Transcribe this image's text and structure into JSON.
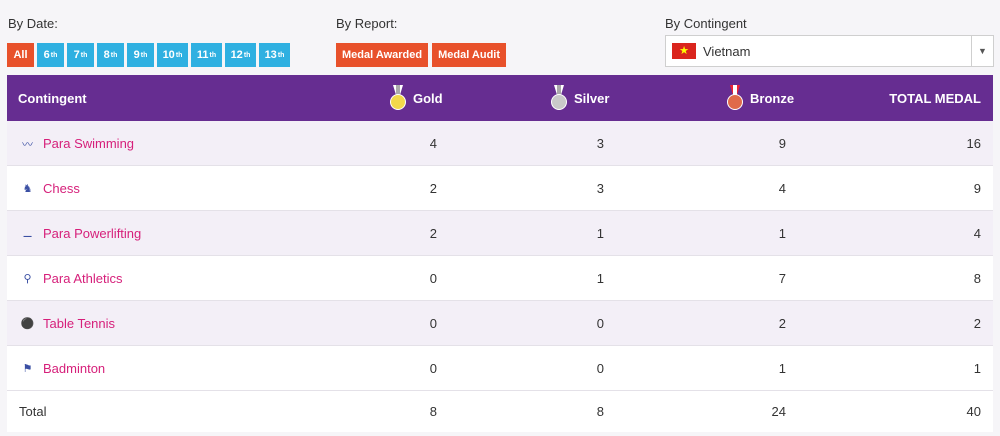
{
  "filters": {
    "date_label": "By Date:",
    "report_label": "By Report:",
    "contingent_label": "By Contingent",
    "date_buttons": [
      {
        "label": "All",
        "sup": ""
      },
      {
        "label": "6",
        "sup": "th"
      },
      {
        "label": "7",
        "sup": "th"
      },
      {
        "label": "8",
        "sup": "th"
      },
      {
        "label": "9",
        "sup": "th"
      },
      {
        "label": "10",
        "sup": "th"
      },
      {
        "label": "11",
        "sup": "th"
      },
      {
        "label": "12",
        "sup": "th"
      },
      {
        "label": "13",
        "sup": "th"
      }
    ],
    "report_buttons": [
      "Medal Awarded",
      "Medal Audit"
    ],
    "contingent_value": "Vietnam",
    "flag_star": "★"
  },
  "colors": {
    "header_bg": "#662d91",
    "date_button": "#2fb0e1",
    "accent_button": "#e8512b",
    "link": "#d61f7a"
  },
  "table": {
    "headers": {
      "contingent": "Contingent",
      "gold": "Gold",
      "silver": "Silver",
      "bronze": "Bronze",
      "total": "TOTAL MEDAL"
    },
    "rows": [
      {
        "sport": "Para Swimming",
        "icon": "swimming-icon",
        "glyph": "〰",
        "gold": "4",
        "silver": "3",
        "bronze": "9",
        "total": "16"
      },
      {
        "sport": "Chess",
        "icon": "chess-icon",
        "glyph": "♞",
        "gold": "2",
        "silver": "3",
        "bronze": "4",
        "total": "9"
      },
      {
        "sport": "Para Powerlifting",
        "icon": "powerlifting-icon",
        "glyph": "⚊",
        "gold": "2",
        "silver": "1",
        "bronze": "1",
        "total": "4"
      },
      {
        "sport": "Para Athletics",
        "icon": "athletics-icon",
        "glyph": "⚲",
        "gold": "0",
        "silver": "1",
        "bronze": "7",
        "total": "8"
      },
      {
        "sport": "Table Tennis",
        "icon": "table-tennis-icon",
        "glyph": "⚫",
        "gold": "0",
        "silver": "0",
        "bronze": "2",
        "total": "2"
      },
      {
        "sport": "Badminton",
        "icon": "badminton-icon",
        "glyph": "⚑",
        "gold": "0",
        "silver": "0",
        "bronze": "1",
        "total": "1"
      }
    ],
    "total": {
      "label": "Total",
      "gold": "8",
      "silver": "8",
      "bronze": "24",
      "total": "40"
    }
  }
}
